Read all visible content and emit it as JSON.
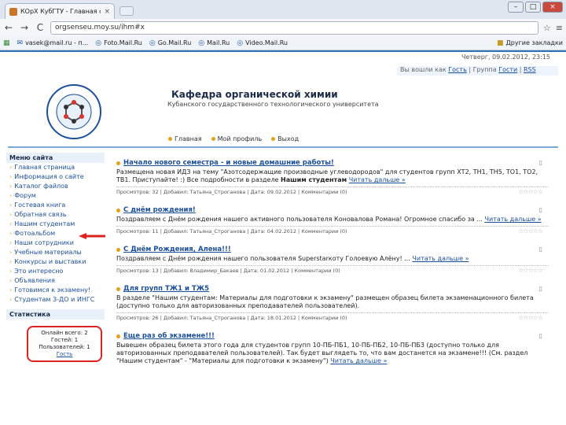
{
  "browser": {
    "tab_title": "КОрХ КубГТУ - Главная ст",
    "tab_close": "×",
    "url": "orgsenseu.moy.su/ihm#x",
    "back": "←",
    "forward": "→",
    "reload": "C",
    "home": "⌂",
    "star": "☆",
    "wrench": "≡",
    "win_min": "–",
    "win_max": "□",
    "win_close": "×",
    "bookmarks": [
      {
        "label": "vasek@mail.ru - п...",
        "icon": "mail-icon"
      },
      {
        "label": "Foto.Mail.Ru",
        "icon": "globe-icon"
      },
      {
        "label": "Go.Mail.Ru",
        "icon": "globe-icon"
      },
      {
        "label": "Mail.Ru",
        "icon": "globe-icon"
      },
      {
        "label": "Video.Mail.Ru",
        "icon": "globe-icon"
      }
    ],
    "other_bookmarks": "Другие закладки"
  },
  "site": {
    "datetime": "Четверг, 09.02.2012, 23:15",
    "user_greeting": "Вы вошли как",
    "user_name": "Гость",
    "user_group": "Группа",
    "group_name": "Гости",
    "rss": "RSS",
    "title": "Кафедра органической химии",
    "subtitle": "Кубанского государственного технологического университета",
    "logo_text": "кафедра органической химии",
    "nav": [
      "Главная",
      "Мой профиль",
      "Выход"
    ]
  },
  "sidebar": {
    "menu_title": "Меню сайта",
    "items": [
      "Главная страница",
      "Информация о сайте",
      "Каталог файлов",
      "Форум",
      "Гостевая книга",
      "Обратная связь",
      "Нашим студентам",
      "Фотоальбом",
      "Наши сотрудники",
      "Учебные материалы",
      "Конкурсы и выставки",
      "Это интересно",
      "Объявления",
      "Готовимся к экзамену!",
      "Студентам З-ДО и ИНГС"
    ],
    "stats_title": "Статистика",
    "stats_lines": [
      "Онлайн всего: 2",
      "Гостей: 1",
      "Пользователей: 1",
      "Гость"
    ]
  },
  "posts": [
    {
      "title": "Начало нового семестра - и новые домашние работы!",
      "body": "Размещена новая ИДЗ на тему \"Азотсодержащие производные углеводородов\" для студентов групп ХТ2, ТН1, ТН5, ТО1, ТО2, ТВ1. Приступайте! :) Все подробности в разделе",
      "bold": "Нашим студентам",
      "more": "Читать дальше »",
      "meta": "Просмотров: 32 | Добавил: Татьяна_Строганова | Дата: 09.02.2012 | Комментарии (0)"
    },
    {
      "title": "С днём рождения!",
      "body": "Поздравляем с Днём рождения нашего активного пользователя Коновалова Романа! Огромное спасибо за ...",
      "bold": "",
      "more": "Читать дальше »",
      "meta": "Просмотров: 11 | Добавил: Татьяна_Строганова | Дата: 04.02.2012 | Комментарии (0)"
    },
    {
      "title": "С Днём Рождения, Алена!!!",
      "body": "Поздравляем с Днём рождения нашего пользователя Superstarкоту Голоевую Алёну! ...",
      "bold": "",
      "more": "Читать дальше »",
      "meta": "Просмотров: 13 | Добавил: Владимир_Бакаев | Дата: 01.02.2012 | Комментарии (0)"
    },
    {
      "title": "Для групп ТЖ1 и ТЖ5",
      "body": "В разделе \"Нашим студентам: Материалы для подготовки к экзамену\" размещен образец билета экзаменационного билета (доступно только для авторизованных преподавателей пользователей).",
      "bold": "",
      "more": "",
      "meta": "Просмотров: 26 | Добавил: Татьяна_Строганова | Дата: 18.01.2012 | Комментарии (0)"
    },
    {
      "title": "Еще раз об экзамене!!!",
      "body": "Вывешен образец билета этого года для студентов групп 10-ПБ-ПБ1, 10-ПБ-ПБ2, 10-ПБ-ПБ3 (доступно только для авторизованных преподавателей пользователей). Так будет выглядеть то, что вам достанется на экзамене!!! (См. раздел \"Нашим студентам\" - \"Материалы для подготовки к экзамену\")",
      "bold": "",
      "more": "Читать дальше »",
      "meta": ""
    }
  ],
  "stars": "☆☆☆☆☆",
  "colors": {
    "accent": "#2f74b8",
    "bullet": "#e5a21a",
    "link": "#1c4f9c",
    "highlight": "#dd2222"
  }
}
